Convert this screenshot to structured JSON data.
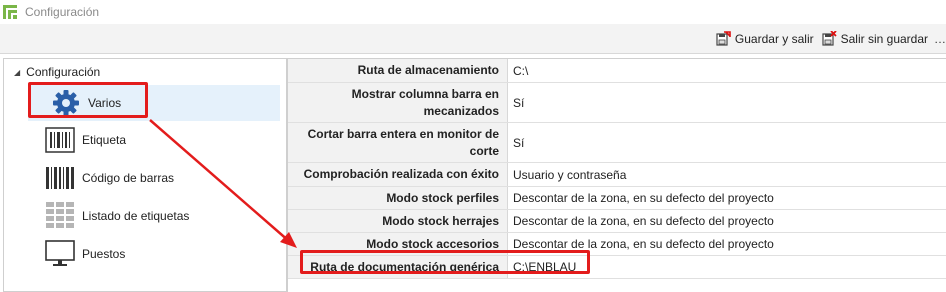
{
  "window": {
    "title": "Configuración"
  },
  "toolbar": {
    "save_exit": "Guardar y salir",
    "exit_no_save": "Salir sin guardar",
    "more": "…"
  },
  "tree": {
    "root": "Configuración",
    "items": [
      {
        "label": "Varios",
        "icon": "gear-icon",
        "selected": true
      },
      {
        "label": "Etiqueta",
        "icon": "label-icon"
      },
      {
        "label": "Código de barras",
        "icon": "barcode-icon"
      },
      {
        "label": "Listado de etiquetas",
        "icon": "label-list-icon"
      },
      {
        "label": "Puestos",
        "icon": "monitor-icon"
      }
    ]
  },
  "properties": [
    {
      "key": "Ruta de almacenamiento",
      "value": "C:\\"
    },
    {
      "key": "Mostrar columna barra en mecanizados",
      "value": "Sí"
    },
    {
      "key": "Cortar barra entera en monitor de corte",
      "value": "Sí"
    },
    {
      "key": "Comprobación realizada con éxito",
      "value": "Usuario y contraseña"
    },
    {
      "key": "Modo stock perfiles",
      "value": "Descontar de la zona, en su defecto del proyecto"
    },
    {
      "key": "Modo stock herrajes",
      "value": "Descontar de la zona, en su defecto del proyecto"
    },
    {
      "key": "Modo stock accesorios",
      "value": "Descontar de la zona, en su defecto del proyecto"
    },
    {
      "key": "Ruta de documentación genérica",
      "value": "C:\\ENBLAU"
    }
  ],
  "colors": {
    "highlight": "#e31c1c",
    "selection": "#e5f1fb",
    "gear": "#2a5fa8",
    "app_icon": "#7ab648"
  }
}
